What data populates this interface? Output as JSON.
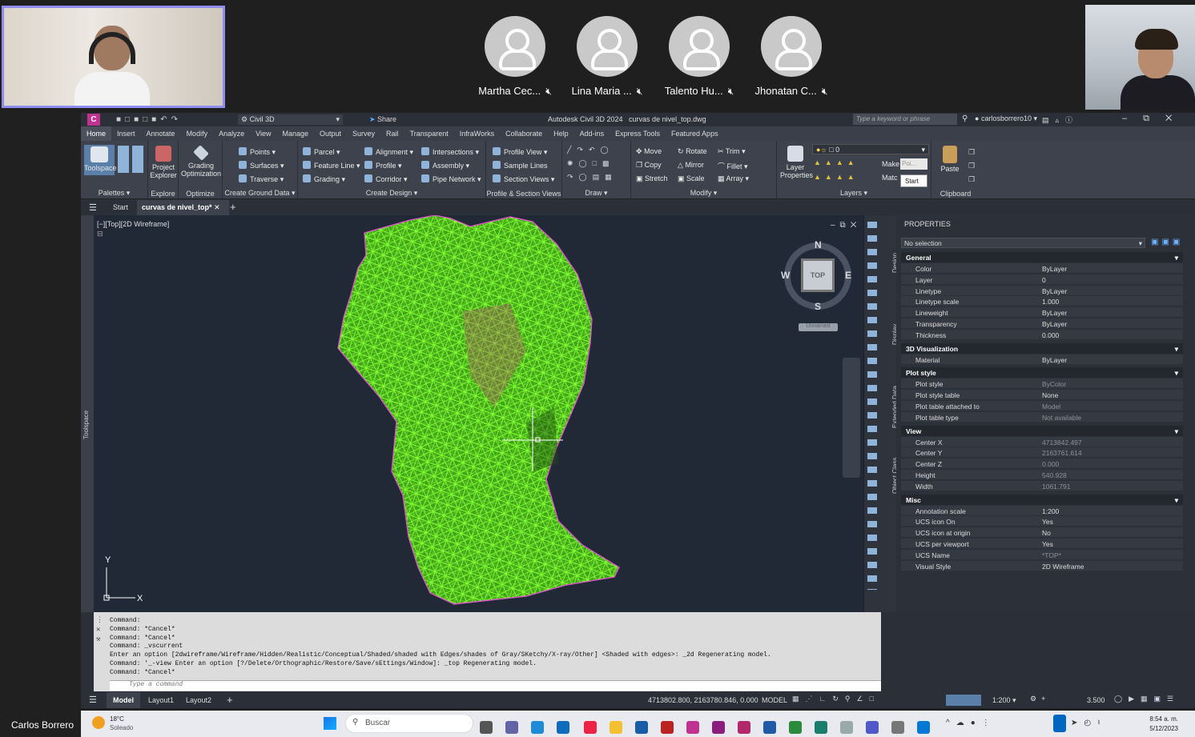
{
  "meeting": {
    "participants": [
      {
        "name": "Martha Cec..."
      },
      {
        "name": "Lina Maria ..."
      },
      {
        "name": "Talento Hu..."
      },
      {
        "name": "Jhonatan C..."
      }
    ],
    "self_name": "Carlos Borrero"
  },
  "app": {
    "workspace": "Civil 3D",
    "share": "Share",
    "title": "Autodesk Civil 3D 2024   curvas de nivel_top.dwg",
    "search_placeholder": "Type a keyword or phrase",
    "user": "carlosborrero10"
  },
  "ribbon_tabs": [
    "Home",
    "Insert",
    "Annotate",
    "Modify",
    "Analyze",
    "View",
    "Manage",
    "Output",
    "Survey",
    "Rail",
    "Transparent",
    "InfraWorks",
    "Collaborate",
    "Help",
    "Add-ins",
    "Express Tools",
    "Featured Apps"
  ],
  "ribbon": {
    "toolspace": "Toolspace",
    "palettes": "Palettes",
    "project_explorer": "Project Explorer",
    "explore": "Explore",
    "grading_optimization": "Grading Optimization",
    "optimize": "Optimize",
    "points": "Points",
    "surfaces": "Surfaces",
    "traverse": "Traverse",
    "create_ground_data": "Create Ground Data",
    "parcel": "Parcel",
    "feature_line": "Feature Line",
    "grading": "Grading",
    "alignment": "Alignment",
    "profile": "Profile",
    "corridor": "Corridor",
    "intersections": "Intersections",
    "assembly": "Assembly",
    "pipe_network": "Pipe Network",
    "create_design": "Create Design",
    "profile_view": "Profile View",
    "sample_lines": "Sample Lines",
    "section_views": "Section Views",
    "profile_section_views": "Profile & Section Views",
    "draw": "Draw",
    "move": "Move",
    "copy": "Copy",
    "stretch": "Stretch",
    "rotate": "Rotate",
    "mirror": "Mirror",
    "scale": "Scale",
    "trim": "Trim",
    "fillet": "Fillet",
    "array": "Array",
    "modify": "Modify",
    "layer_properties": "Layer Properties",
    "layer_value": "0",
    "make": "Make",
    "match": "Matc",
    "layers": "Layers",
    "tooltip_poi": "Poi...",
    "tooltip_start": "Start",
    "paste": "Paste",
    "clipboard": "Clipboard"
  },
  "doc_tabs": {
    "start": "Start",
    "file": "curvas de nivel_top*"
  },
  "viewport": {
    "label": "[−][Top][2D Wireframe]",
    "compass": {
      "n": "N",
      "s": "S",
      "e": "E",
      "w": "W",
      "top": "TOP",
      "ucs": "Unnamed"
    },
    "axis_x": "X",
    "axis_y": "Y"
  },
  "toolspace_label": "Toolspace",
  "properties": {
    "title": "PROPERTIES",
    "selection": "No selection",
    "side_tabs": [
      "Design",
      "Display",
      "Extended Data",
      "Object Class"
    ],
    "sections": [
      {
        "name": "General",
        "rows": [
          {
            "k": "Color",
            "v": "ByLayer"
          },
          {
            "k": "Layer",
            "v": "0"
          },
          {
            "k": "Linetype",
            "v": "ByLayer"
          },
          {
            "k": "Linetype scale",
            "v": "1.000"
          },
          {
            "k": "Lineweight",
            "v": "ByLayer"
          },
          {
            "k": "Transparency",
            "v": "ByLayer"
          },
          {
            "k": "Thickness",
            "v": "0.000"
          }
        ]
      },
      {
        "name": "3D Visualization",
        "rows": [
          {
            "k": "Material",
            "v": "ByLayer"
          }
        ]
      },
      {
        "name": "Plot style",
        "rows": [
          {
            "k": "Plot style",
            "v": "ByColor"
          },
          {
            "k": "Plot style table",
            "v": "None"
          },
          {
            "k": "Plot table attached to",
            "v": "Model"
          },
          {
            "k": "Plot table type",
            "v": "Not available"
          }
        ]
      },
      {
        "name": "View",
        "rows": [
          {
            "k": "Center X",
            "v": "4713842.497"
          },
          {
            "k": "Center Y",
            "v": "2163761.614"
          },
          {
            "k": "Center Z",
            "v": "0.000"
          },
          {
            "k": "Height",
            "v": "540.928"
          },
          {
            "k": "Width",
            "v": "1061.791"
          }
        ]
      },
      {
        "name": "Misc",
        "rows": [
          {
            "k": "Annotation scale",
            "v": "1:200"
          },
          {
            "k": "UCS icon On",
            "v": "Yes"
          },
          {
            "k": "UCS icon at origin",
            "v": "No"
          },
          {
            "k": "UCS per viewport",
            "v": "Yes"
          },
          {
            "k": "UCS Name",
            "v": "*TOP*"
          },
          {
            "k": "Visual Style",
            "v": "2D Wireframe"
          }
        ]
      }
    ]
  },
  "command": {
    "lines": "Command:\nCommand: *Cancel*\nCommand: *Cancel*\nCommand: _vscurrent\nEnter an option [2dwireframe/Wireframe/Hidden/Realistic/Conceptual/Shaded/shaded with Edges/shades of Gray/SKetchy/X-ray/Other] <Shaded with edges>: _2d Regenerating model.\nCommand: '_-view Enter an option [?/Delete/Orthographic/Restore/Save/sEttings/Window]: _top Regenerating model.\nCommand: *Cancel*",
    "placeholder": "Type a command"
  },
  "status": {
    "tabs": [
      "Model",
      "Layout1",
      "Layout2"
    ],
    "coords": "4713802.800, 2163780.846, 0.000",
    "model": "MODEL",
    "scale": "1:200",
    "value": "3.500"
  },
  "taskbar": {
    "weather_temp": "18°C",
    "weather_desc": "Soleado",
    "search": "Buscar",
    "time": "8:54 a. m.",
    "date": "5/12/2023"
  }
}
